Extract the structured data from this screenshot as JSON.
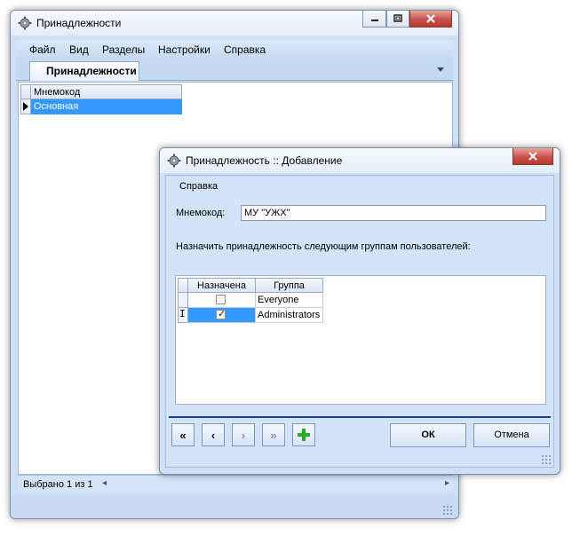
{
  "main_window": {
    "title": "Принадлежности",
    "menu": [
      "Файл",
      "Вид",
      "Разделы",
      "Настройки",
      "Справка"
    ],
    "tab": "Принадлежности",
    "grid": {
      "column": "Мнемокод",
      "rows": [
        "Основная"
      ]
    },
    "status": "Выбрано 1 из 1"
  },
  "dialog": {
    "title": "Принадлежность :: Добавление",
    "menu": [
      "Справка"
    ],
    "mnemocode_label": "Мнемокод:",
    "mnemocode_value": "МУ \"УЖХ\"",
    "assign_label": "Назначить принадлежность следующим группам пользователей:",
    "grid": {
      "columns": [
        "Назначена",
        "Группа"
      ],
      "rows": [
        {
          "assigned": false,
          "group": "Everyone"
        },
        {
          "assigned": true,
          "group": "Administrators"
        }
      ]
    },
    "nav_buttons": [
      "«",
      "‹",
      "›",
      "»"
    ],
    "ok_label": "ОК",
    "cancel_label": "Отмена"
  },
  "colors": {
    "selection": "#3399ff",
    "accent_line": "#1d3f8f",
    "add_icon": "#2fa82f",
    "close_button": "#c75050"
  },
  "icons": [
    "gear-icon",
    "minimize-icon",
    "maximize-icon",
    "close-icon",
    "plus-icon",
    "resize-grip-icon"
  ]
}
